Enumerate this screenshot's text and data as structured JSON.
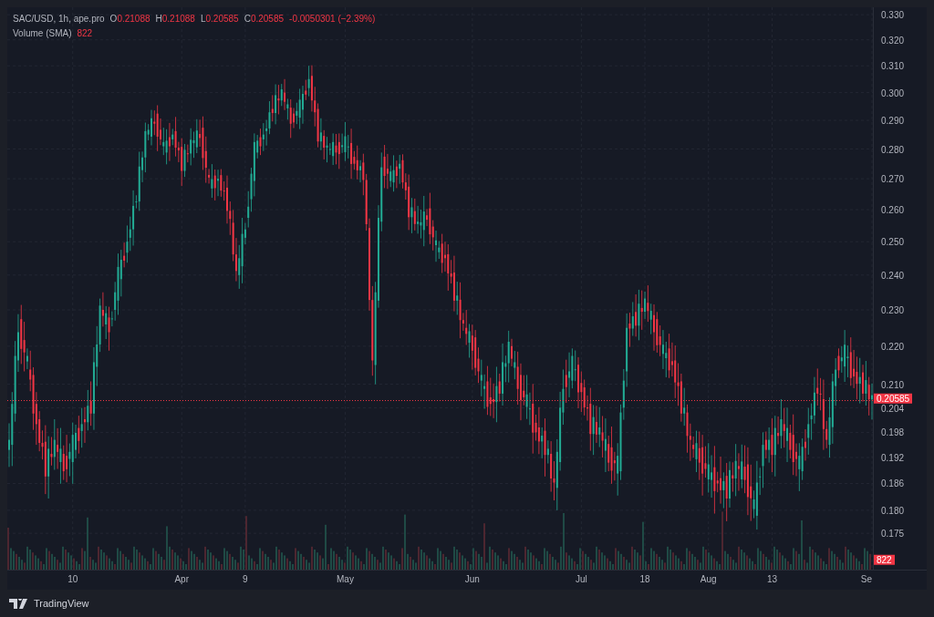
{
  "legend": {
    "symbol": "SAC/USD, 1h, ape.pro",
    "ohlc": [
      {
        "key": "O",
        "value": "0.21088"
      },
      {
        "key": "H",
        "value": "0.21088"
      },
      {
        "key": "L",
        "value": "0.20585"
      },
      {
        "key": "C",
        "value": "0.20585"
      }
    ],
    "change": "-0.0050301 (−2.39%)",
    "volume_label": "Volume (SMA)",
    "volume_value": "822"
  },
  "price_axis": [
    "0.330",
    "0.320",
    "0.310",
    "0.300",
    "0.290",
    "0.280",
    "0.270",
    "0.260",
    "0.250",
    "0.240",
    "0.230",
    "0.220",
    "0.210",
    "0.204",
    "0.198",
    "0.192",
    "0.186",
    "0.180",
    "0.175"
  ],
  "time_axis": [
    "10",
    "Apr",
    "9",
    "May",
    "Jun",
    "Jul",
    "18",
    "Aug",
    "13",
    "Se"
  ],
  "last_price": {
    "label": "0.20585"
  },
  "volume_badge": "822",
  "footer": {
    "brand": "TradingView"
  }
}
